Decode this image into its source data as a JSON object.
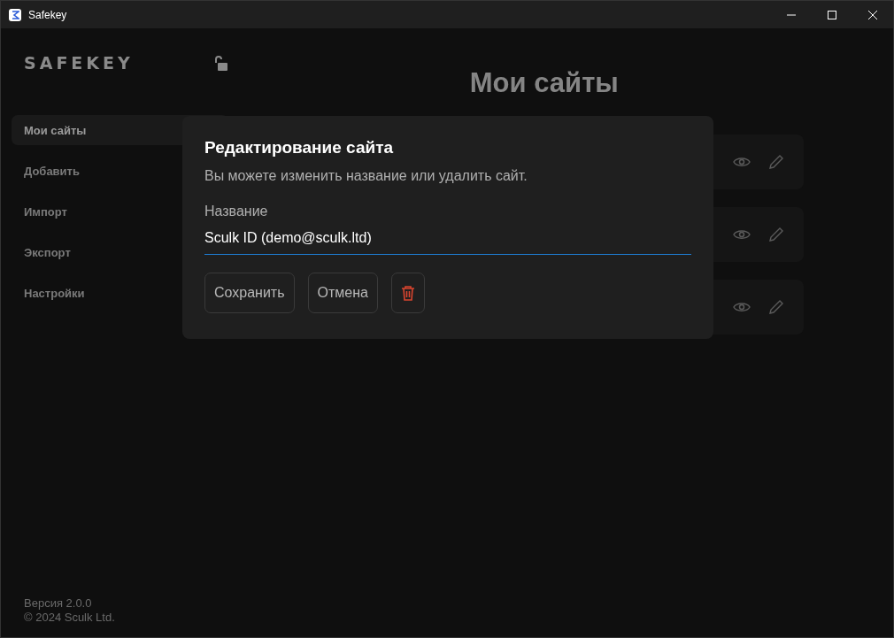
{
  "window": {
    "title": "Safekey"
  },
  "sidebar": {
    "logo": "SAFEKEY",
    "items": [
      {
        "label": "Мои сайты",
        "selected": true
      },
      {
        "label": "Добавить",
        "selected": false
      },
      {
        "label": "Импорт",
        "selected": false
      },
      {
        "label": "Экспорт",
        "selected": false
      },
      {
        "label": "Настройки",
        "selected": false
      }
    ],
    "version": "Версия 2.0.0",
    "copyright": "© 2024 Sculk Ltd."
  },
  "page": {
    "title": "Мои сайты"
  },
  "dialog": {
    "title": "Редактирование сайта",
    "description": "Вы можете изменить название или удалить сайт.",
    "field_label": "Название",
    "field_value": "Sculk ID (demo@sculk.ltd)",
    "buttons": [
      "Сохранить",
      "Отмена"
    ]
  }
}
